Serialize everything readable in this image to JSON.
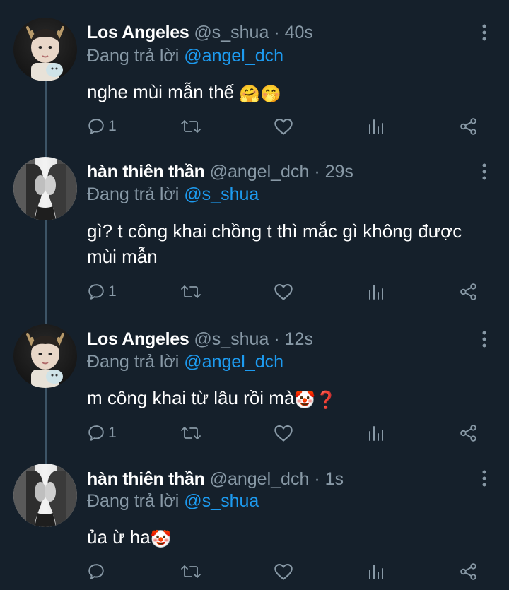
{
  "thread": [
    {
      "name": "Los Angeles",
      "handle": "@s_shua",
      "sep": "·",
      "time": "40s",
      "replying_prefix": "Đang trả lời",
      "replying_to": "@angel_dch",
      "text": "nghe mùi mẫn thế",
      "emoji": "🤗🤭",
      "reply_count": "1",
      "avatar": "boy-antlers"
    },
    {
      "name": "hàn thiên thần",
      "handle": "@angel_dch",
      "sep": "·",
      "time": "29s",
      "replying_prefix": "Đang trả lời",
      "replying_to": "@s_shua",
      "text": "gì? t công khai chồng t thì mắc gì không được mùi mẫn",
      "emoji": "",
      "reply_count": "1",
      "avatar": "mono-two-faces"
    },
    {
      "name": "Los Angeles",
      "handle": "@s_shua",
      "sep": "·",
      "time": "12s",
      "replying_prefix": "Đang trả lời",
      "replying_to": "@angel_dch",
      "text": "m công khai từ lâu rồi mà",
      "emoji": "🤡❓",
      "reply_count": "1",
      "avatar": "boy-antlers"
    },
    {
      "name": "hàn thiên thần",
      "handle": "@angel_dch",
      "sep": "·",
      "time": "1s",
      "replying_prefix": "Đang trả lời",
      "replying_to": "@s_shua",
      "text": "ủa ừ ha",
      "emoji": "🤡",
      "reply_count": "",
      "avatar": "mono-two-faces"
    }
  ],
  "icons": {
    "reply": "reply-icon",
    "retweet": "retweet-icon",
    "like": "heart-icon",
    "analytics": "analytics-icon",
    "share": "share-icon",
    "more": "more-vertical-icon"
  },
  "colors": {
    "background": "#15202b",
    "secondary_text": "#8899a6",
    "mention": "#1d9bf0",
    "thread_line": "#3d5466"
  }
}
